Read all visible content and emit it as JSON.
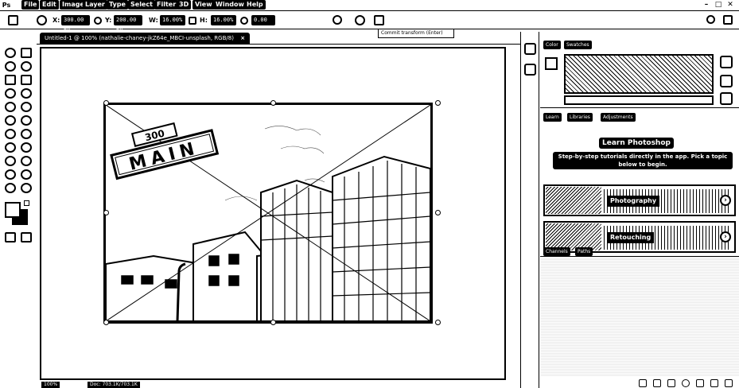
{
  "menubar": {
    "logo": "Ps",
    "items": [
      "File",
      "Edit",
      "Image",
      "Layer",
      "Type",
      "Select",
      "Filter",
      "3D",
      "View",
      "Window",
      "Help"
    ],
    "window_controls": [
      "–",
      "□",
      "✕"
    ]
  },
  "options": {
    "x_label": "X:",
    "x_value": "300.00 px",
    "y_label": "Y:",
    "y_value": "200.00 px",
    "w_label": "W:",
    "w_value": "16.00%",
    "h_label": "H:",
    "h_value": "16.00%",
    "angle_value": "0.00",
    "commit_tooltip": "Commit transform (Enter)"
  },
  "document": {
    "tab_title": "Untitled-1 @ 100% (nathalie-chaney-jkZ64e_MBCI-unsplash, RGB/8)",
    "tab_close": "×",
    "zoom": "100%",
    "doc_size": "Doc: 703.1K/703.1K"
  },
  "photo": {
    "sign_number": "300",
    "sign_text": "MAIN"
  },
  "right": {
    "color_tabs": [
      "Color",
      "Swatches"
    ],
    "learn_tabs": [
      "Learn",
      "Libraries",
      "Adjustments"
    ],
    "learn_title": "Learn Photoshop",
    "learn_subtitle": "Step-by-step tutorials directly in the app. Pick a topic below to begin.",
    "cards": [
      "Photography",
      "Retouching"
    ],
    "layers_tabs": [
      "Channels",
      "Paths"
    ]
  }
}
